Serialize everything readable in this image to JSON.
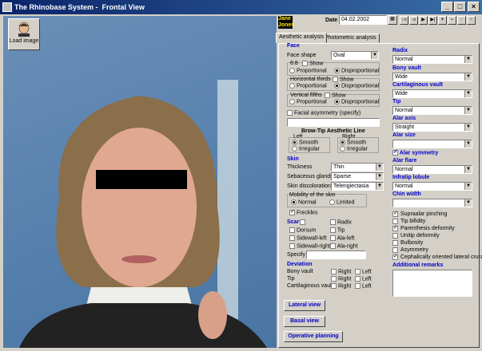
{
  "window": {
    "title": "The Rhinobase System -  Frontal View"
  },
  "toolbar": {
    "load_image_label": "Load image"
  },
  "patient": {
    "name_line1": "Jane",
    "name_line2": "Jones"
  },
  "date": {
    "label": "Date",
    "value": "04.02.2002"
  },
  "nav": {
    "first": "|◀",
    "prev": "◀",
    "next": "▶",
    "last": "▶|",
    "add": "+",
    "remove": "−",
    "confirm": "✓",
    "cancel": "✕"
  },
  "tabs": [
    {
      "label": "Aesthetic analysis"
    },
    {
      "label": "Photometric analysis"
    }
  ],
  "face": {
    "header": "Face",
    "shape_label": "Face shape",
    "shape_value": "Oval",
    "ratio_label": "6:8",
    "show_label": "Show",
    "proportional": "Proportional",
    "disproportional": "Disproportional",
    "horizontal_thirds": "Horizontal thirds",
    "vertical_fifths": "Vertical fifths",
    "facial_asymmetry": "Facial asymmetry (specify)",
    "brow_tip_title": "Brow-Tip Aesthetic Line",
    "left": "Left",
    "right": "Right",
    "smooth": "Smooth",
    "irregular": "Irregular"
  },
  "skin": {
    "header": "Skin",
    "thickness_label": "Thickness",
    "thickness_value": "Thin",
    "sebaceous_label": "Sebaceous glands",
    "sebaceous_value": "Sparse",
    "discoloration_label": "Skin discoloration",
    "discoloration_value": "Telengiectasia",
    "mobility_label": "Mobility of the skin",
    "normal": "Normal",
    "limited": "Limited",
    "freckles": "Freckles"
  },
  "scar": {
    "header": "Scar",
    "dorsum": "Dorsum",
    "sidewall_left": "Sidewall-left",
    "sidewall_right": "Sidewall-right",
    "radix": "Radix",
    "tip": "Tip",
    "ala_left": "Ala-left",
    "ala_right": "Ala-right",
    "specify": "Specify"
  },
  "deviation": {
    "header": "Deviation",
    "bony_vault": "Bony vault",
    "tip": "Tip",
    "cartilaginous_vault": "Cartilaginous vault",
    "right": "Right",
    "left": "Left"
  },
  "right_panel": {
    "radix_label": "Radix",
    "radix_value": "Normal",
    "bony_vault_label": "Bony vault",
    "bony_vault_value": "Wide",
    "cart_vault_label": "Cartilaginous vault",
    "cart_vault_value": "Wide",
    "tip_label": "Tip",
    "tip_value": "Normal",
    "alar_axis_label": "Alar axis",
    "alar_axis_value": "Straight",
    "alar_size_label": "Alar size",
    "alar_size_value": "",
    "alar_symmetry": "Alar symmetry",
    "alar_flare_label": "Alar flare",
    "alar_flare_value": "Normal",
    "infratip_label": "Infratip lobule",
    "infratip_value": "Normal",
    "chin_width_label": "Chin width",
    "chin_width_value": "",
    "checks": [
      {
        "label": "Supraalar pinching",
        "on": true
      },
      {
        "label": "Tip bifidity",
        "on": false
      },
      {
        "label": "Parenthesis deformity",
        "on": true
      },
      {
        "label": "Unitip deformity",
        "on": false
      },
      {
        "label": "Bulbosity",
        "on": false
      },
      {
        "label": "Asymmetry",
        "on": false
      },
      {
        "label": "Cephalically oriented lateral crura",
        "on": true
      }
    ],
    "additional_remarks": "Additional remarks"
  },
  "buttons": {
    "lateral": "Lateral view",
    "basal": "Basal view",
    "operative": "Operative planning"
  }
}
